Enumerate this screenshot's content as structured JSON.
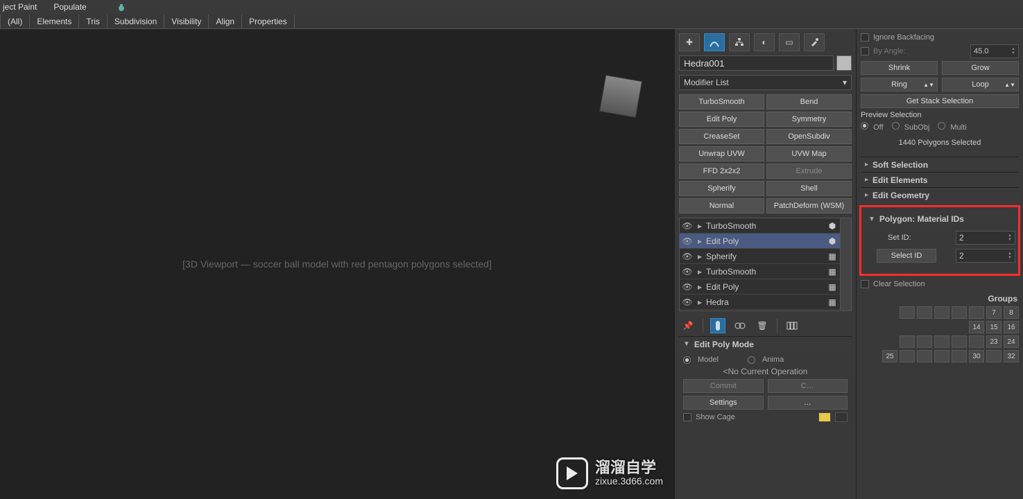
{
  "menubar": {
    "item1": "ject Paint",
    "item2": "Populate"
  },
  "tabbar": {
    "all": "(All)",
    "elements": "Elements",
    "tris": "Tris",
    "subdivision": "Subdivision",
    "visibility": "Visibility",
    "align": "Align",
    "properties": "Properties"
  },
  "viewport": {
    "placeholder": "[3D Viewport — soccer ball model with red pentagon polygons selected]"
  },
  "object": {
    "name": "Hedra001"
  },
  "modifier_list_label": "Modifier List",
  "modifiers": {
    "turbosmooth": "TurboSmooth",
    "bend": "Bend",
    "editpoly": "Edit Poly",
    "symmetry": "Symmetry",
    "creaseset": "CreaseSet",
    "opensubdiv": "OpenSubdiv",
    "unwrap": "Unwrap UVW",
    "uvwmap": "UVW Map",
    "ffd": "FFD 2x2x2",
    "extrude": "Extrude",
    "spherify": "Spherify",
    "shell": "Shell",
    "normal": "Normal",
    "patchdeform": "PatchDeform (WSM)"
  },
  "stack": [
    {
      "label": "TurboSmooth"
    },
    {
      "label": "Edit Poly",
      "sel": true
    },
    {
      "label": "Spherify"
    },
    {
      "label": "TurboSmooth"
    },
    {
      "label": "Edit Poly"
    },
    {
      "label": "Hedra"
    }
  ],
  "edit_poly_mode": {
    "header": "Edit Poly Mode",
    "model": "Model",
    "anima": "Anima",
    "no_op": "<No Current Operation",
    "commit": "Commit",
    "settings": "Settings",
    "show_cage": "Show Cage"
  },
  "selection": {
    "ignore_backfacing": "Ignore Backfacing",
    "by_angle": "By Angle:",
    "by_angle_val": "45.0",
    "shrink": "Shrink",
    "grow": "Grow",
    "ring": "Ring",
    "loop": "Loop",
    "get_stack": "Get Stack Selection",
    "preview": "Preview Selection",
    "off": "Off",
    "subobj": "SubObj",
    "multi": "Multi",
    "count": "1440 Polygons Selected"
  },
  "rollouts": {
    "soft": "Soft Selection",
    "edit_elem": "Edit Elements",
    "edit_geom": "Edit Geometry",
    "material": "Polygon: Material IDs",
    "set_id": "Set ID:",
    "set_id_val": "2",
    "select_id": "Select ID",
    "select_id_val": "2",
    "clear_sel": "Clear Selection",
    "groups": "Groups"
  },
  "groups_row1": [
    "",
    "",
    "",
    "",
    "",
    "7",
    "8"
  ],
  "groups_row3": [
    "",
    "",
    "",
    "",
    "",
    "23",
    "24"
  ],
  "groups_row4": [
    "25",
    "",
    "",
    "",
    "",
    "30",
    "",
    "32"
  ],
  "watermark": {
    "brand": "溜溜自学",
    "url": "zixue.3d66.com"
  }
}
